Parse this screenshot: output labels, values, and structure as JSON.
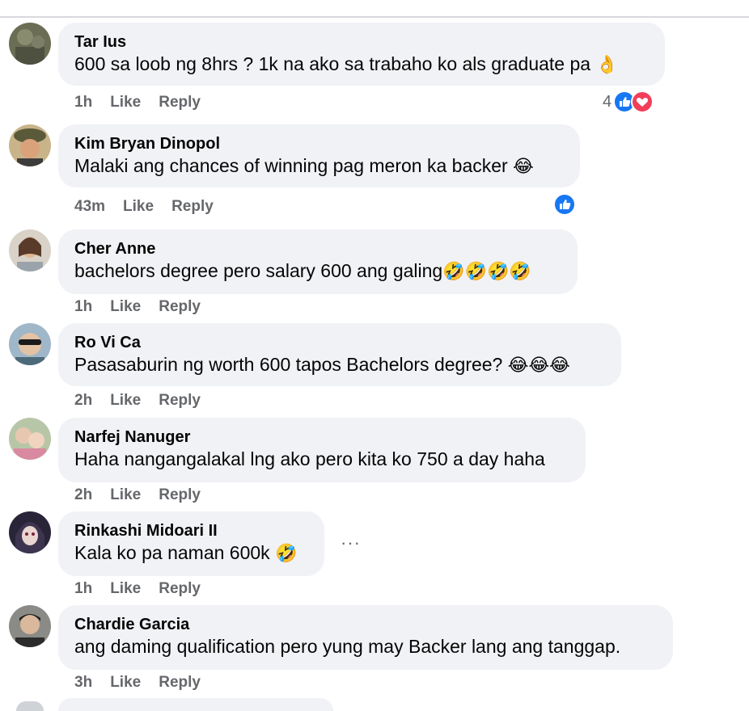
{
  "comments": [
    {
      "author": "Tar Ius",
      "text": "600 sa loob ng 8hrs ? 1k na ako sa trabaho ko als graduate pa ",
      "emoji": "👌",
      "time": "1h",
      "like_label": "Like",
      "reply_label": "Reply",
      "reactions": {
        "count": "4",
        "types": [
          "like-icon",
          "love-icon"
        ]
      }
    },
    {
      "author": "Kim Bryan Dinopol",
      "text": "Malaki ang chances of winning pag meron ka backer ",
      "emoji": "😂",
      "time": "43m",
      "like_label": "Like",
      "reply_label": "Reply",
      "reactions": {
        "count": "",
        "types": [
          "like-icon"
        ]
      }
    },
    {
      "author": "Cher Anne",
      "text": "bachelors degree pero salary 600 ang galing",
      "emoji": "🤣🤣🤣🤣",
      "time": "1h",
      "like_label": "Like",
      "reply_label": "Reply"
    },
    {
      "author": "Ro Vi Ca",
      "text": "Pasasaburin ng worth 600 tapos Bachelors degree? ",
      "emoji": "😂😂😂",
      "time": "2h",
      "like_label": "Like",
      "reply_label": "Reply"
    },
    {
      "author": "Narfej Nanuger",
      "text": "Haha nangangalakal lng ako pero kita ko 750 a day haha",
      "emoji": "",
      "time": "2h",
      "like_label": "Like",
      "reply_label": "Reply"
    },
    {
      "author": "Rinkashi Midoari II",
      "text": "Kala ko pa naman 600k ",
      "emoji": "🤣",
      "time": "1h",
      "like_label": "Like",
      "reply_label": "Reply",
      "more_label": "···"
    },
    {
      "author": "Chardie Garcia",
      "text": "ang daming qualification pero yung may Backer lang ang tanggap.",
      "emoji": "",
      "time": "3h",
      "like_label": "Like",
      "reply_label": "Reply"
    }
  ],
  "colors": {
    "bubble_bg": "#f0f2f5",
    "meta_text": "#65676b",
    "like_blue": "#1877f2",
    "love_red": "#f33e58"
  }
}
